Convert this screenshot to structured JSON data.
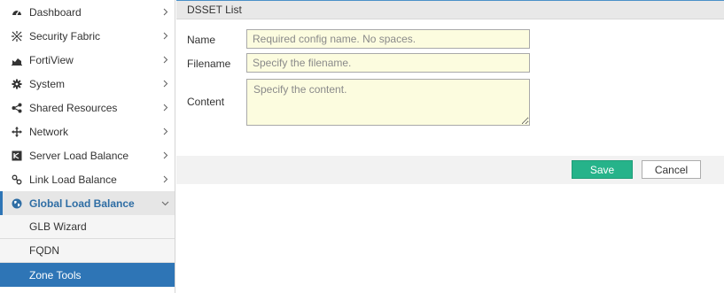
{
  "sidebar": {
    "items": [
      {
        "label": "Dashboard",
        "icon": "dashboard-icon"
      },
      {
        "label": "Security Fabric",
        "icon": "security-fabric-icon"
      },
      {
        "label": "FortiView",
        "icon": "fortiview-chart-icon"
      },
      {
        "label": "System",
        "icon": "gear-icon"
      },
      {
        "label": "Shared Resources",
        "icon": "share-icon"
      },
      {
        "label": "Network",
        "icon": "arrows-move-icon"
      },
      {
        "label": "Server Load Balance",
        "icon": "server-load-balance-icon"
      },
      {
        "label": "Link Load Balance",
        "icon": "link-icon"
      },
      {
        "label": "Global Load Balance",
        "icon": "globe-icon",
        "expanded": true
      }
    ],
    "sub_items": [
      {
        "label": "GLB Wizard"
      },
      {
        "label": "FQDN"
      },
      {
        "label": "Zone Tools",
        "selected": true
      }
    ]
  },
  "panel": {
    "title": "DSSET List"
  },
  "form": {
    "name_label": "Name",
    "name_placeholder": "Required config name. No spaces.",
    "filename_label": "Filename",
    "filename_placeholder": "Specify the filename.",
    "content_label": "Content",
    "content_placeholder": "Specify the content."
  },
  "buttons": {
    "save": "Save",
    "cancel": "Cancel"
  },
  "colors": {
    "accent": "#2e75b6",
    "save_button": "#26b38a",
    "field_bg": "#fcfcdf"
  }
}
